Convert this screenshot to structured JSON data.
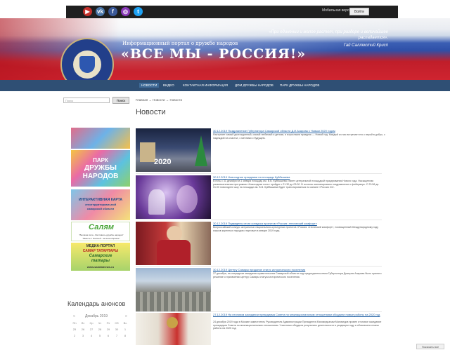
{
  "topbar": {
    "social": [
      "youtube-icon",
      "vk-icon",
      "facebook-icon",
      "instagram-icon",
      "twitter-icon"
    ],
    "mobile_label": "Мобильная версия",
    "mobile_button": "Войти",
    "gplus": "G+"
  },
  "header": {
    "seal_text": "ДН",
    "portal_subtitle": "Информационный портал о дружбе народов",
    "big_title": "«ВСЕ МЫ - РОССИЯ!»",
    "quote": "«При единении и малое растет, при раздоре и величайшее распадается».",
    "quote_author": "Гай Саллюстий Крисп"
  },
  "nav": {
    "items": [
      "НОВОСТИ",
      "ВИДЕО",
      "КОНТАКТНАЯ ИНФОРМАЦИЯ",
      "ДОМ ДРУЖБЫ НАРОДОВ",
      "ПАРК ДРУЖБЫ НАРОДОВ"
    ]
  },
  "search": {
    "placeholder": "Поиск",
    "button": "Поиск"
  },
  "breadcrumb": "Главная → Новости → Новости",
  "page_title": "Новости",
  "banners": {
    "park_line1": "ПАРК",
    "park_line2": "ДРУЖБЫ",
    "park_line3": "НАРОДОВ",
    "map_line1": "ИНТЕРАКТИВНАЯ КАРТА",
    "map_line2": "этнотерриториальной",
    "map_line3": "самарской области",
    "salam_title": "Салям",
    "salam_sub1": "\"Великая сила - Фестиваль дружбы народов\"",
    "salam_sub2": "\"Вместе с Россией - за многообразие\"",
    "media_line1": "МЕДИА-ПОРТАЛ",
    "media_line2": "САМАР ТАТАРЛАРЫ",
    "media_line3": "Самарские",
    "media_line4": "татары",
    "media_url": "www.samtatnews.ru"
  },
  "calendar": {
    "title": "Календарь анонсов",
    "month": "Декабрь 2019",
    "prev": "«",
    "next": "»",
    "weekdays": [
      "Пн",
      "Вт",
      "Ср",
      "Чт",
      "Пт",
      "Сб",
      "Вс"
    ],
    "row1": [
      "25",
      "26",
      "27",
      "28",
      "29",
      "30",
      "1"
    ],
    "row2": [
      "2",
      "3",
      "4",
      "5",
      "6",
      "7",
      "8"
    ]
  },
  "news": [
    {
      "date": "30.12.2019",
      "title": "Поздравление Губернатора Самарской области Д.И.Азарова с Новым 2020 годом",
      "text": "Наступает самый долгожданный, самый любимый и детьми, и взрослыми праздник — Новый год. Каждый из нас встречает его с верой в добро, с надеждой на счастье, с мечтами о будущем.",
      "image_label": "2020"
    },
    {
      "date": "30.12.2019",
      "title": "Новогодние праздники на площади Куйбышева",
      "text": "В ночь с 31 декабря на 1 января площадь им. В.В. Куйбышева станет центральной площадкой празднования Нового года. Насыщенная развлекательная программа «Новогодняя ночь» пройдет с 21:30 до 03:00. В полночь запланировано поздравление и фейерверк. С 23:58 до 01:00 новогоднее шоу на площади им. В.В. Куйбышева будет транслироваться на канале «Россия 24»."
    },
    {
      "date": "30.12.2019",
      "title": "Подведены итоги конкурса проектов «Россия: этнический комфорт»",
      "text": "Всероссийский конкурс актуальных национально-культурных проектов «Россия: этнический комфорт», посвященный Международному году языков коренных народов стартовал в январе 2019 года."
    },
    {
      "date": "30.12.2019",
      "title": "Центру Самары придание статус исторического поселения",
      "text": "27 декабря, на очередном заседании правительства Самарской области под председательством Губернатора Дмитрия Азарова было принято решение о присвоении центру Самары статуса исторического поселения."
    },
    {
      "date": "27.12.2019",
      "title": "На итоговом заседании президиума Совета по межнациональным отношениям обсудили новые работы на 2020 год",
      "text": "24 декабря 2019 года в Москве заместитель Руководителя Администрации Президента Магомедсалам Магомедов провел итоговое заседание президиума Совета по межнациональным отношениям. Участники обсудили результаты деятельности в уходящем году и обозначили планы работы на 2025 год."
    }
  ],
  "bottom_button": "Показать все"
}
